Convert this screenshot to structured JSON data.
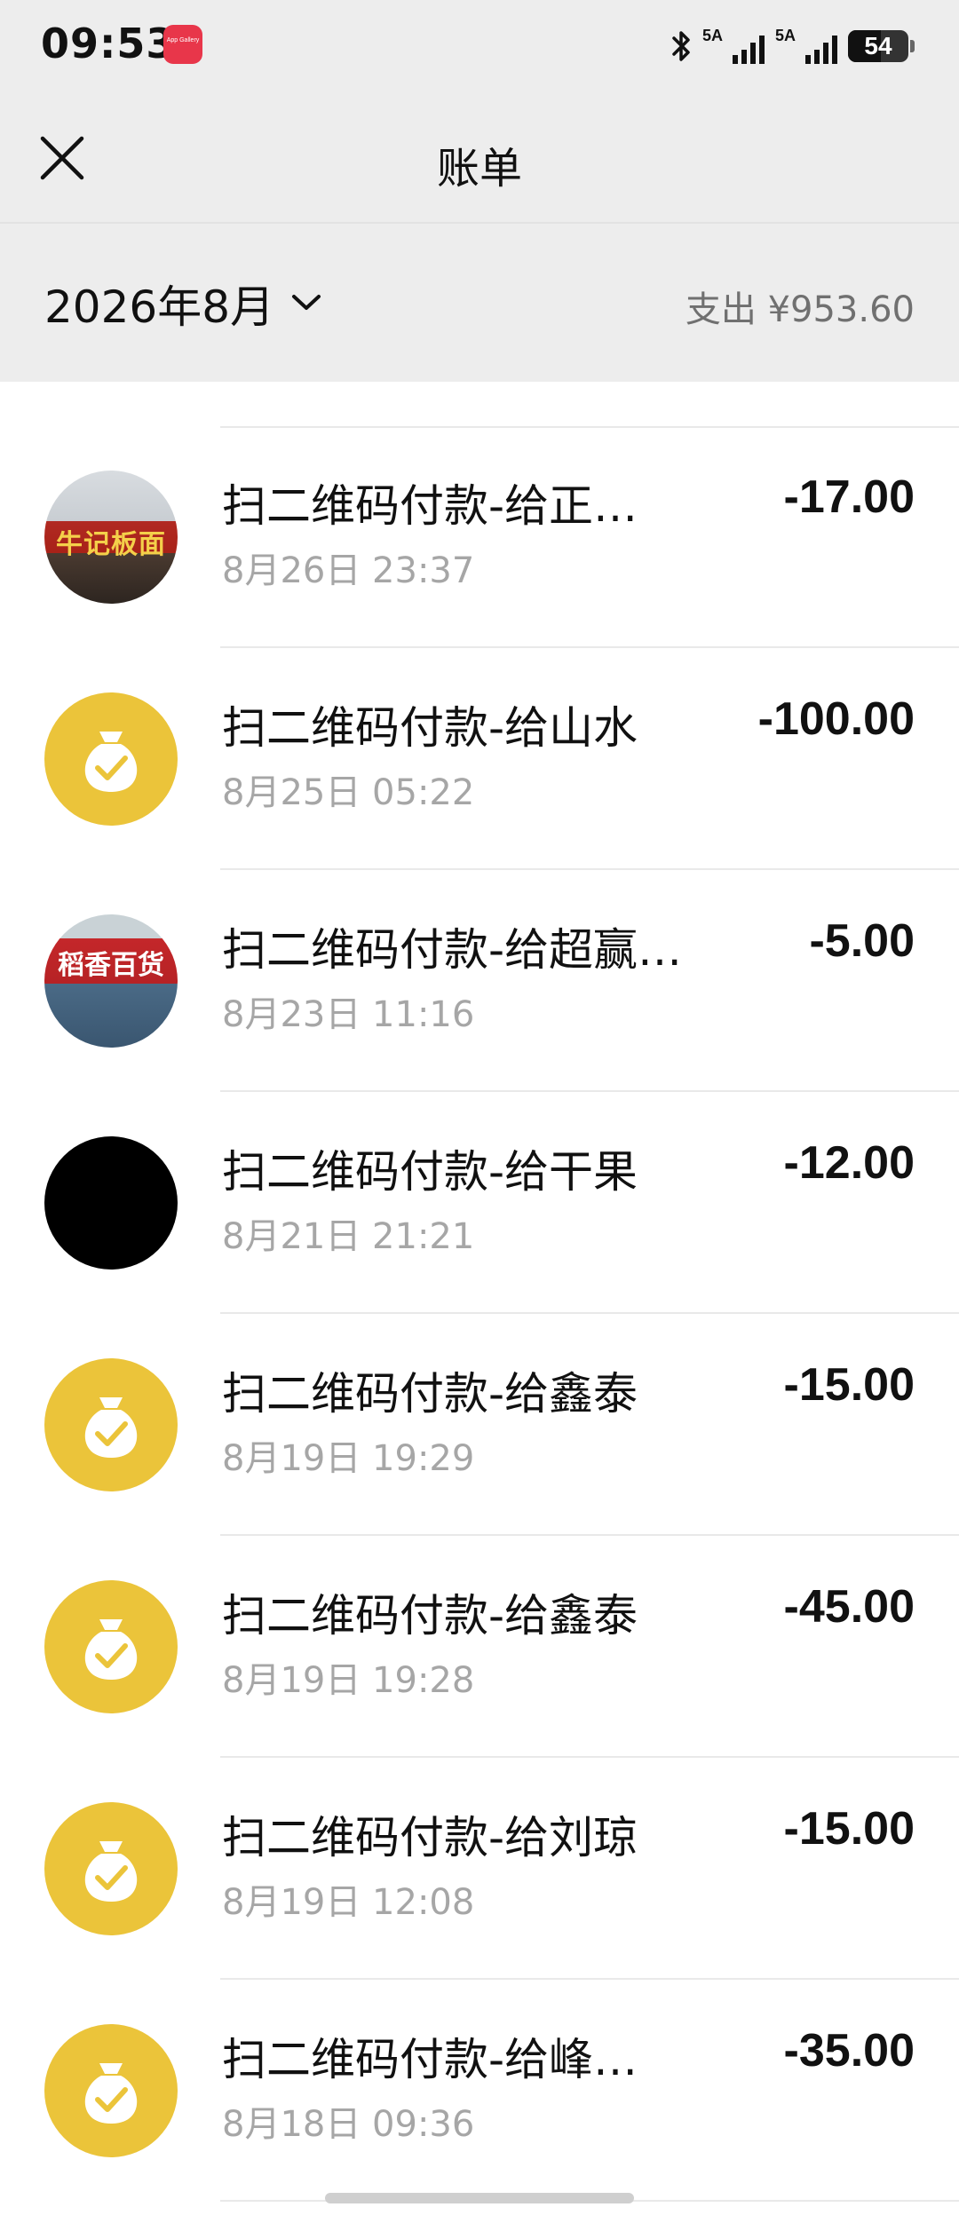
{
  "status_bar": {
    "time": "09:53",
    "app_gallery_label": "App Gallery",
    "signal_1_label": "5A",
    "signal_2_label": "5A",
    "battery_level": "54",
    "icons": [
      "appgallery-icon",
      "bluetooth-icon",
      "signal-icon",
      "signal-icon",
      "battery-icon"
    ]
  },
  "header": {
    "title": "账单",
    "close_icon": "close-icon"
  },
  "filter": {
    "month": "2026年8月",
    "dropdown_icon": "chevron-down-icon",
    "summary": "支出 ¥953.60"
  },
  "colors": {
    "header_bg": "#ededed",
    "moneybag_yellow": "#ebc43a",
    "secondary_text": "#a6a6a6"
  },
  "transactions": [
    {
      "title": "扫二维码付款-给正…",
      "time": "8月26日 23:37",
      "amount": "-17.00",
      "avatar": "shop-photo",
      "avatar_text": "牛记板面"
    },
    {
      "title": "扫二维码付款-给山水",
      "time": "8月25日 05:22",
      "amount": "-100.00",
      "avatar": "moneybag-icon"
    },
    {
      "title": "扫二维码付款-给超赢…",
      "time": "8月23日 11:16",
      "amount": "-5.00",
      "avatar": "shop-photo",
      "avatar_text": "稻香百货"
    },
    {
      "title": "扫二维码付款-给干果",
      "time": "8月21日 21:21",
      "amount": "-12.00",
      "avatar": "black-avatar"
    },
    {
      "title": "扫二维码付款-给鑫泰",
      "time": "8月19日 19:29",
      "amount": "-15.00",
      "avatar": "moneybag-icon"
    },
    {
      "title": "扫二维码付款-给鑫泰",
      "time": "8月19日 19:28",
      "amount": "-45.00",
      "avatar": "moneybag-icon"
    },
    {
      "title": "扫二维码付款-给刘琼",
      "time": "8月19日 12:08",
      "amount": "-15.00",
      "avatar": "moneybag-icon"
    },
    {
      "title": "扫二维码付款-给峰…",
      "time": "8月18日 09:36",
      "amount": "-35.00",
      "avatar": "moneybag-icon"
    }
  ]
}
